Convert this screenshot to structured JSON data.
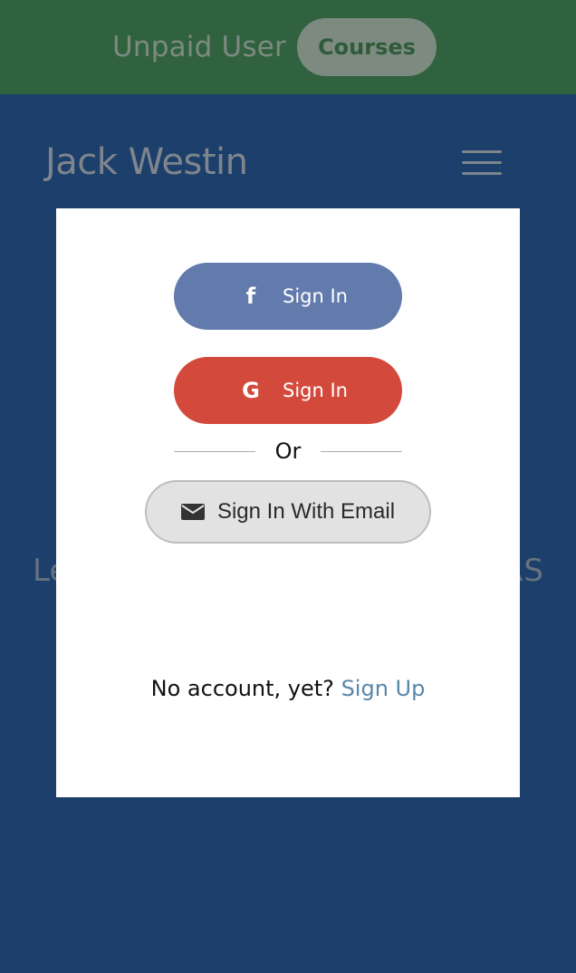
{
  "topbar": {
    "user_label": "Unpaid User",
    "courses_label": "Courses"
  },
  "navbar": {
    "brand": "Jack Westin"
  },
  "background": {
    "heading_left": "Le",
    "heading_right": "RS"
  },
  "modal": {
    "facebook_signin": {
      "icon": "facebook-icon",
      "label": "Sign In"
    },
    "google_signin": {
      "icon": "google-icon",
      "label": "Sign In"
    },
    "divider_text": "Or",
    "email_signin": {
      "icon": "envelope-icon",
      "label": "Sign In With Email"
    },
    "signup_prompt": "No account, yet?",
    "signup_link": "Sign Up"
  },
  "colors": {
    "topbar_bg": "#316240",
    "page_bg": "#1c3f6b",
    "facebook": "#627aac",
    "google": "#d34a3d",
    "link": "#5a86a8"
  }
}
